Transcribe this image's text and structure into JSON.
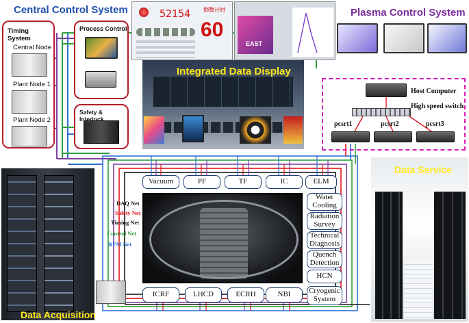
{
  "colors": {
    "daq_net": "#1a1a1a",
    "safety_net": "#e0161b",
    "timing_net": "#7b3fa0",
    "control_net": "#2e9e3c",
    "rfm_net": "#2c6fd6",
    "panel_border": "#b41c2b",
    "title_blue": "#1e4fa8",
    "title_yellow": "#ffe81a",
    "dashed_border": "#d21fb6"
  },
  "central_control": {
    "title": "Central Control System",
    "timing_system": "Timing System",
    "central_node": "Central Node",
    "plant_node_1": "Plant Node 1",
    "plant_node_2": "Plant Node 2",
    "process_control": "Process Control",
    "safety_interlock": "Safety & Interlock"
  },
  "integrated_display": {
    "title": "Integrated Data Display",
    "counter_value": "52154",
    "countdown_label": "倒数计时",
    "countdown_value": "60",
    "logo_text": "EAST"
  },
  "plasma_control": {
    "title": "Plasma Control System",
    "host_computer": "Host Computer",
    "switch": "High speed switch",
    "nodes": [
      "pcsrt1",
      "pcsrt2",
      "pcsrt3"
    ]
  },
  "networks": {
    "daq": "DAQ Net",
    "safety": "Safety Net",
    "timing": "Timing Net",
    "control": "Control Net",
    "rfm": "RFM Net"
  },
  "subsystems_top": [
    "Vacuum",
    "PF",
    "TF",
    "IC",
    "ELM"
  ],
  "subsystems_right": [
    "Water Cooling",
    "Radiation Survey",
    "Technical Diagnosis",
    "Quench Detection",
    "HCN",
    "Cryogenic System"
  ],
  "subsystems_bottom": [
    "ICRF",
    "LHCD",
    "ECRH",
    "NBI"
  ],
  "data_service": {
    "title": "Data Service"
  },
  "data_acquisition": {
    "title": "Data Acquisition"
  }
}
